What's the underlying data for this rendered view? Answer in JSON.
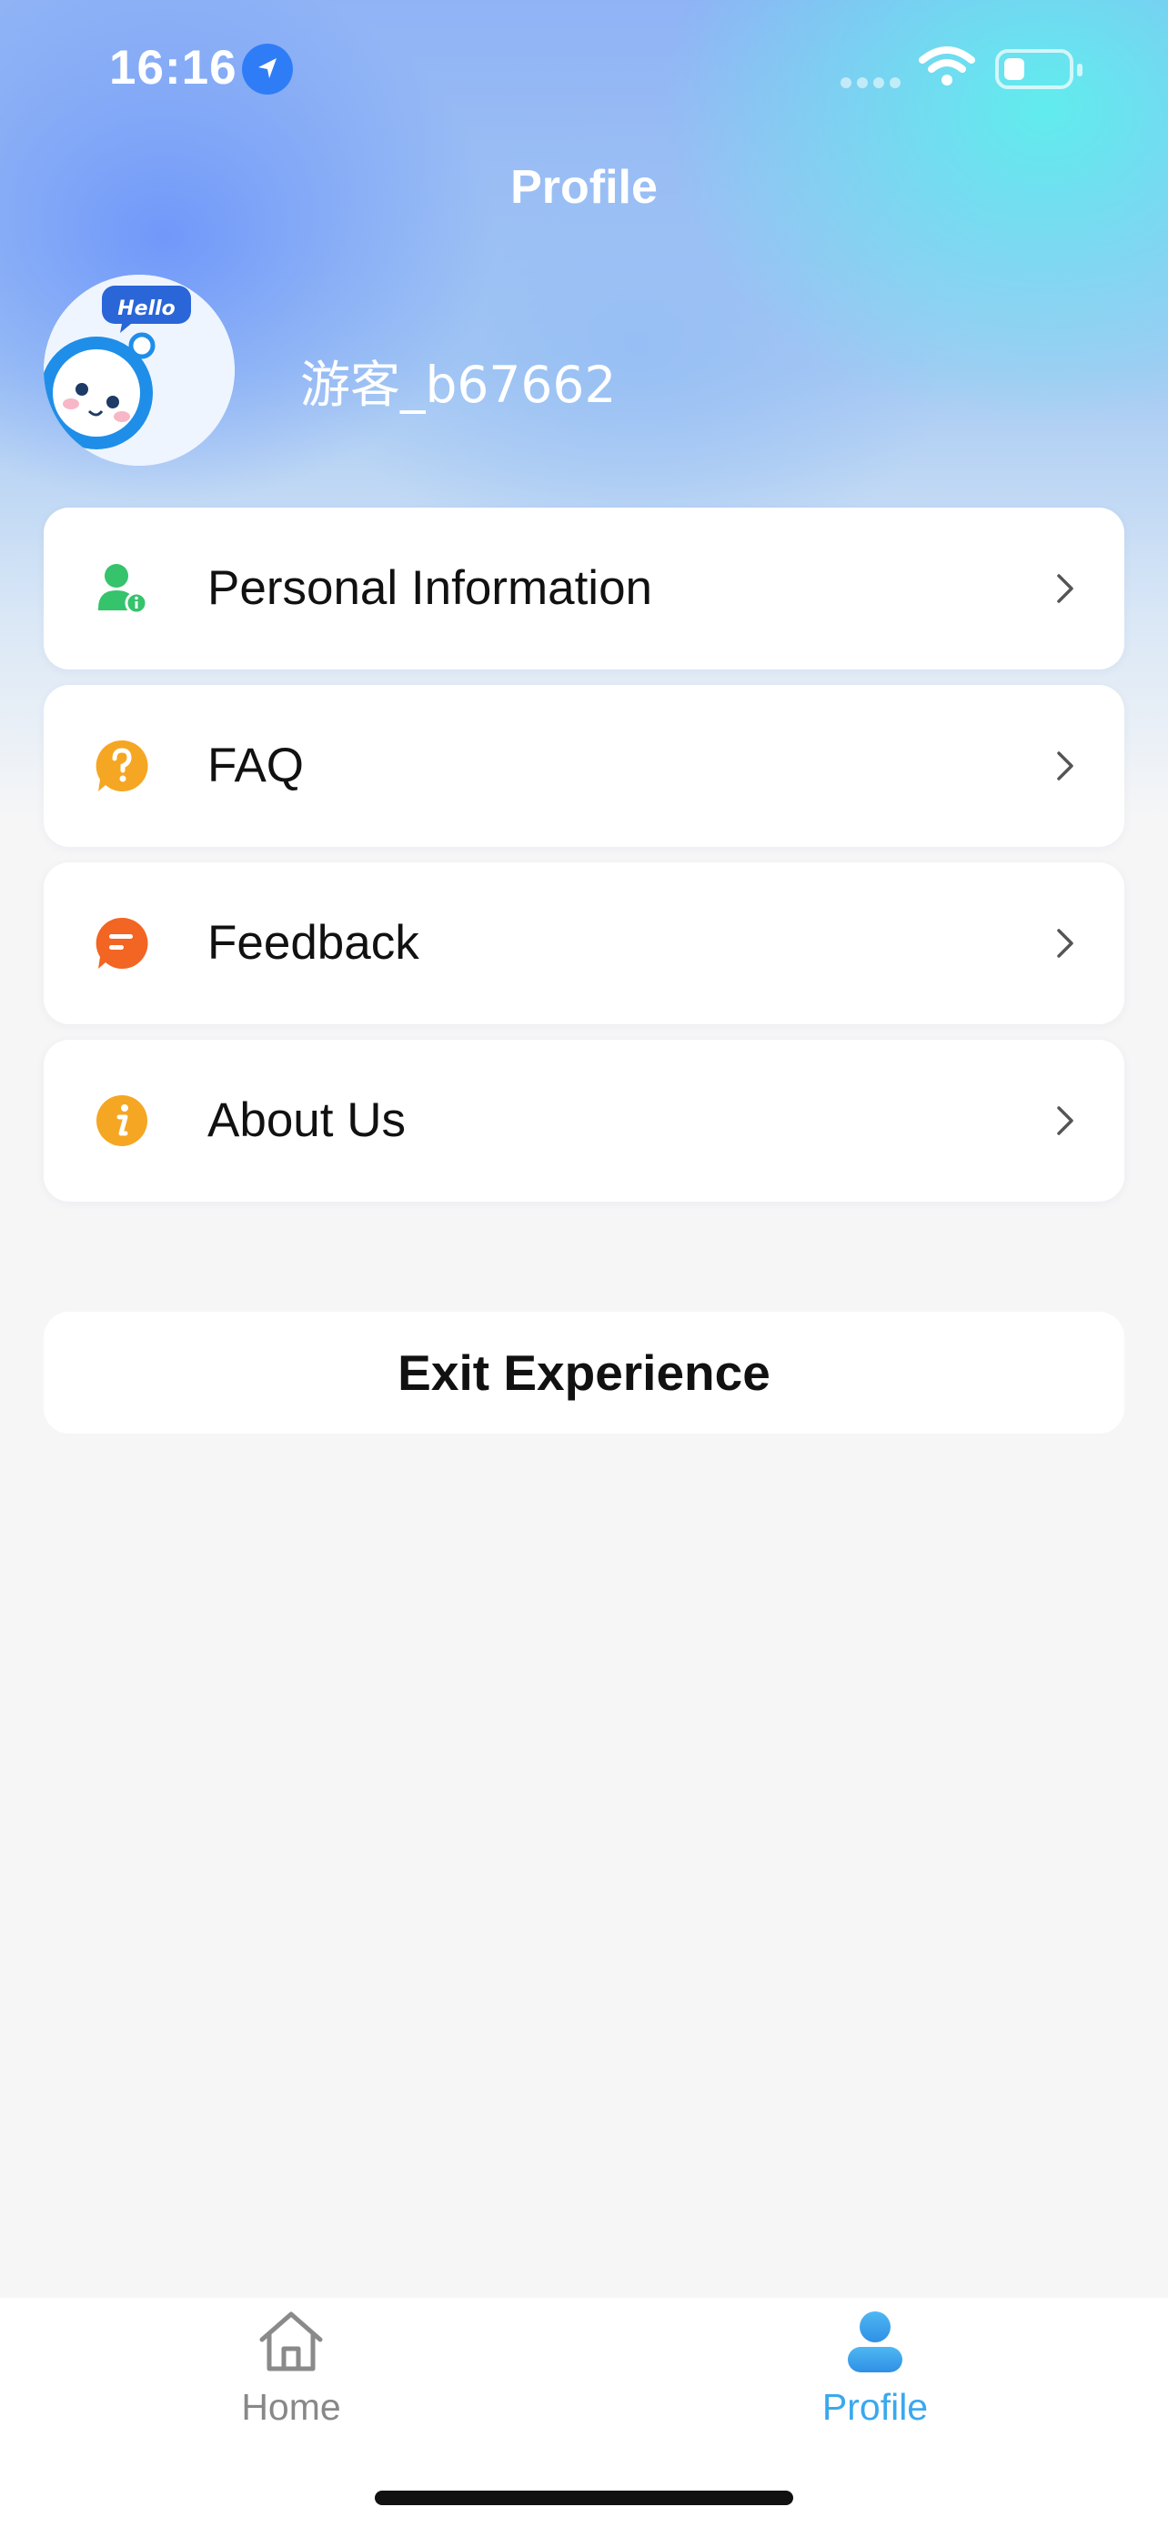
{
  "status_bar": {
    "time": "16:16",
    "icons": [
      "location-arrow-icon",
      "signal-dots-icon",
      "wifi-icon",
      "battery-icon"
    ]
  },
  "header": {
    "title": "Profile"
  },
  "profile": {
    "avatar_badge": "Hello",
    "username": "游客_b67662"
  },
  "menu": {
    "items": [
      {
        "label": "Personal Information",
        "icon": "user-info-icon",
        "color": "#35c36b"
      },
      {
        "label": "FAQ",
        "icon": "question-icon",
        "color": "#f5a623"
      },
      {
        "label": "Feedback",
        "icon": "feedback-icon",
        "color": "#f26522"
      },
      {
        "label": "About Us",
        "icon": "info-icon",
        "color": "#f5a623"
      }
    ]
  },
  "actions": {
    "exit_label": "Exit Experience"
  },
  "tabbar": {
    "tabs": [
      {
        "label": "Home",
        "icon": "home-icon",
        "active": false,
        "color": "#888888"
      },
      {
        "label": "Profile",
        "icon": "profile-icon",
        "active": true,
        "color": "#3aa8ee"
      }
    ]
  }
}
